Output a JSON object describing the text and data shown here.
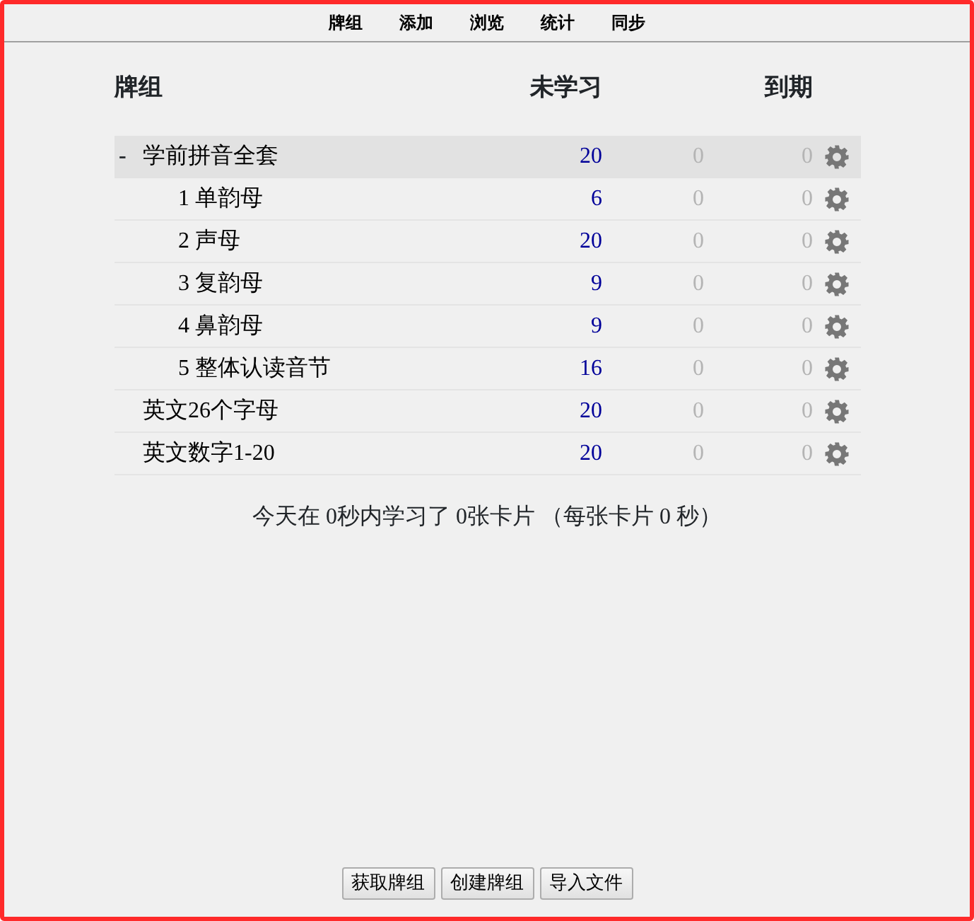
{
  "toolbar": [
    {
      "label": "牌组"
    },
    {
      "label": "添加"
    },
    {
      "label": "浏览"
    },
    {
      "label": "统计"
    },
    {
      "label": "同步"
    }
  ],
  "columns": {
    "deck": "牌组",
    "new": "未学习",
    "due": "到期"
  },
  "decks": [
    {
      "name": "学前拼音全套",
      "expanded": true,
      "current": true,
      "new": "20",
      "learn": "0",
      "due": "0",
      "collapse_sign": "-",
      "children": [
        {
          "name": "1 单韵母",
          "current": false,
          "new": "6",
          "learn": "0",
          "due": "0"
        },
        {
          "name": "2 声母",
          "current": false,
          "new": "20",
          "learn": "0",
          "due": "0"
        },
        {
          "name": "3 复韵母",
          "current": false,
          "new": "9",
          "learn": "0",
          "due": "0"
        },
        {
          "name": "4 鼻韵母",
          "current": false,
          "new": "9",
          "learn": "0",
          "due": "0"
        },
        {
          "name": "5 整体认读音节",
          "current": false,
          "new": "16",
          "learn": "0",
          "due": "0"
        }
      ]
    },
    {
      "name": "英文26个字母",
      "current": false,
      "new": "20",
      "learn": "0",
      "due": "0"
    },
    {
      "name": "英文数字1-20",
      "current": false,
      "new": "20",
      "learn": "0",
      "due": "0"
    }
  ],
  "summary": "今天在 0秒内学习了 0张卡片 （每张卡片 0 秒）",
  "buttons": [
    {
      "label": "获取牌组"
    },
    {
      "label": "创建牌组"
    },
    {
      "label": "导入文件"
    }
  ]
}
